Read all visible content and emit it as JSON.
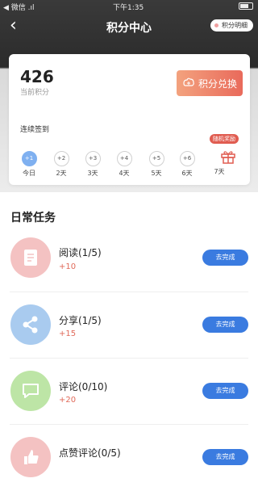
{
  "status_bar": {
    "carrier": "◀ 微信 .ıl",
    "time": "下午1:35"
  },
  "nav": {
    "back_icon": "chevron-left-icon",
    "title": "积分中心",
    "detail_label": "积分明细"
  },
  "points_card": {
    "points": "426",
    "points_label": "当前积分",
    "exchange_label": "积分兑换",
    "sign_label": "连续签到",
    "days": [
      {
        "bubble": "+1",
        "label": "今日",
        "active": true
      },
      {
        "bubble": "+2",
        "label": "2天"
      },
      {
        "bubble": "+3",
        "label": "3天"
      },
      {
        "bubble": "+4",
        "label": "4天"
      },
      {
        "bubble": "+5",
        "label": "5天"
      },
      {
        "bubble": "+6",
        "label": "6天"
      }
    ],
    "gift_tag": "随机奖励",
    "gift_label": "7天"
  },
  "tasks_section": {
    "title": "日常任务",
    "button_label": "去完成",
    "tasks": [
      {
        "name": "阅读(1/5)",
        "points": "+10",
        "color": "#f4c2c2",
        "icon": "document-icon"
      },
      {
        "name": "分享(1/5)",
        "points": "+15",
        "color": "#a9cbef",
        "icon": "share-icon"
      },
      {
        "name": "评论(0/10)",
        "points": "+20",
        "color": "#bde5a6",
        "icon": "comment-icon"
      },
      {
        "name": "点赞评论(0/5)",
        "points": "",
        "color": "#f4c2c2",
        "icon": "thumbs-up-icon"
      }
    ]
  }
}
